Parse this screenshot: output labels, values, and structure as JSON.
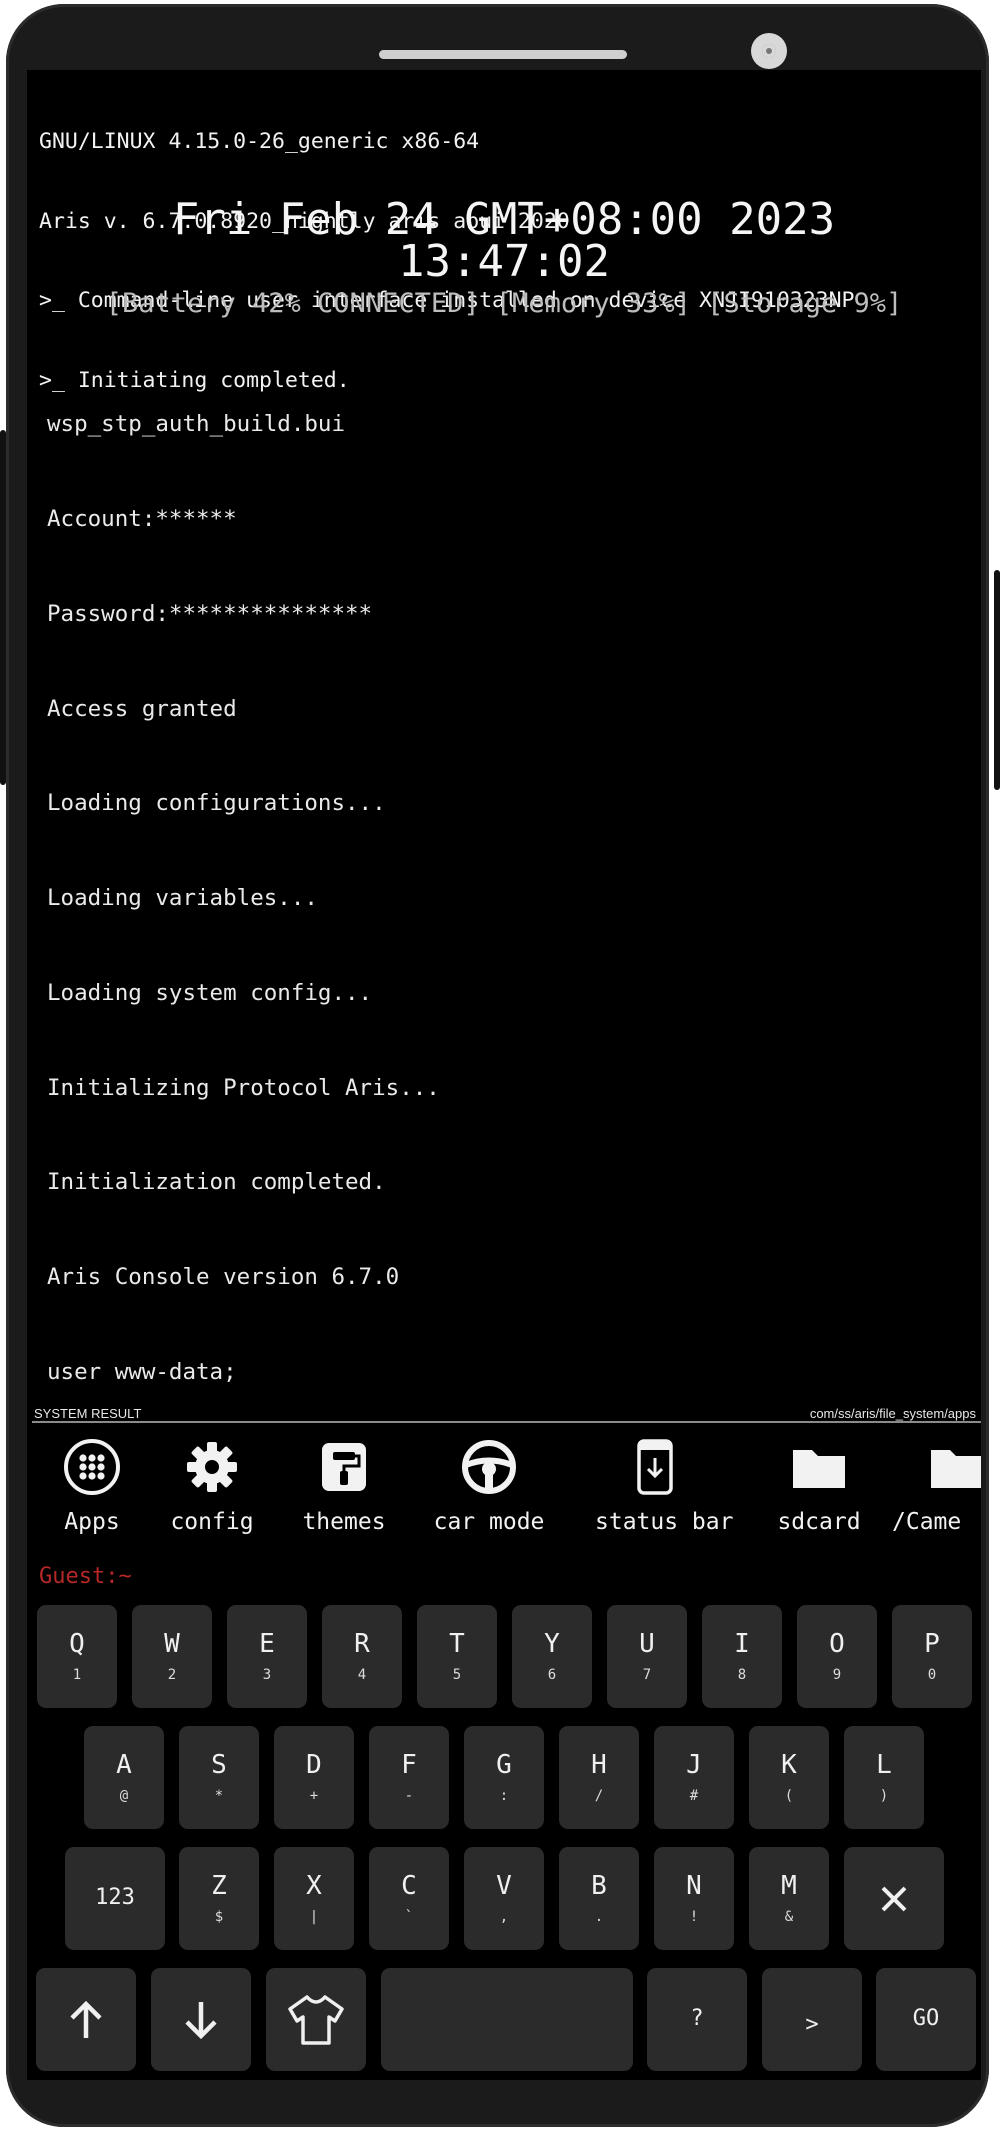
{
  "system_lines": [
    "GNU/LINUX 4.15.0-26_generic x86-64",
    "Aris v. 6.7.0.8920_nightly aris abui 2020",
    ">_ Command-line user interface installed on device XNJI910323NP",
    ">_ Initiating completed."
  ],
  "clock": {
    "date": "Fri Feb 24 GMT+08:00 2023",
    "time": "13:47:02"
  },
  "status_line": "[Battery 42% CONNECTED] [Memory 33%] [Storage 9%]",
  "console_log": [
    "wsp_stp_auth_build.bui",
    "Account:******",
    "Password:***************",
    "Access granted",
    "Loading configurations...",
    "Loading variables...",
    "Loading system config...",
    "Initializing Protocol Aris...",
    "Initialization completed.",
    "Aris Console version 6.7.0",
    "user www-data;"
  ],
  "result_bar": {
    "label": "SYSTEM RESULT",
    "path": "com/ss/aris/file_system/apps"
  },
  "apps": [
    {
      "label": "Apps",
      "icon": "apps-grid-icon"
    },
    {
      "label": "config",
      "icon": "gear-icon"
    },
    {
      "label": "themes",
      "icon": "paint-roller-icon"
    },
    {
      "label": "car mode",
      "icon": "steering-wheel-icon"
    },
    {
      "label": "status bar",
      "icon": "phone-status-icon"
    },
    {
      "label": "sdcard",
      "icon": "folder-icon"
    },
    {
      "label": "/Came",
      "icon": "folder-icon"
    }
  ],
  "prompt": "Guest:~",
  "keyboard": {
    "row1": [
      {
        "main": "Q",
        "sub": "1"
      },
      {
        "main": "W",
        "sub": "2"
      },
      {
        "main": "E",
        "sub": "3"
      },
      {
        "main": "R",
        "sub": "4"
      },
      {
        "main": "T",
        "sub": "5"
      },
      {
        "main": "Y",
        "sub": "6"
      },
      {
        "main": "U",
        "sub": "7"
      },
      {
        "main": "I",
        "sub": "8"
      },
      {
        "main": "O",
        "sub": "9"
      },
      {
        "main": "P",
        "sub": "0"
      }
    ],
    "row2": [
      {
        "main": "A",
        "sub": "@"
      },
      {
        "main": "S",
        "sub": "*"
      },
      {
        "main": "D",
        "sub": "+"
      },
      {
        "main": "F",
        "sub": "-"
      },
      {
        "main": "G",
        "sub": ":"
      },
      {
        "main": "H",
        "sub": "/"
      },
      {
        "main": "J",
        "sub": "#"
      },
      {
        "main": "K",
        "sub": "("
      },
      {
        "main": "L",
        "sub": ")"
      }
    ],
    "row3": [
      {
        "main": "Z",
        "sub": "$"
      },
      {
        "main": "X",
        "sub": "|"
      },
      {
        "main": "C",
        "sub": "`"
      },
      {
        "main": "V",
        "sub": ","
      },
      {
        "main": "B",
        "sub": "."
      },
      {
        "main": "N",
        "sub": "!"
      },
      {
        "main": "M",
        "sub": "&"
      }
    ],
    "numbers_key": "123",
    "question_key": "?",
    "greater_key": ">",
    "go_key": "GO"
  }
}
